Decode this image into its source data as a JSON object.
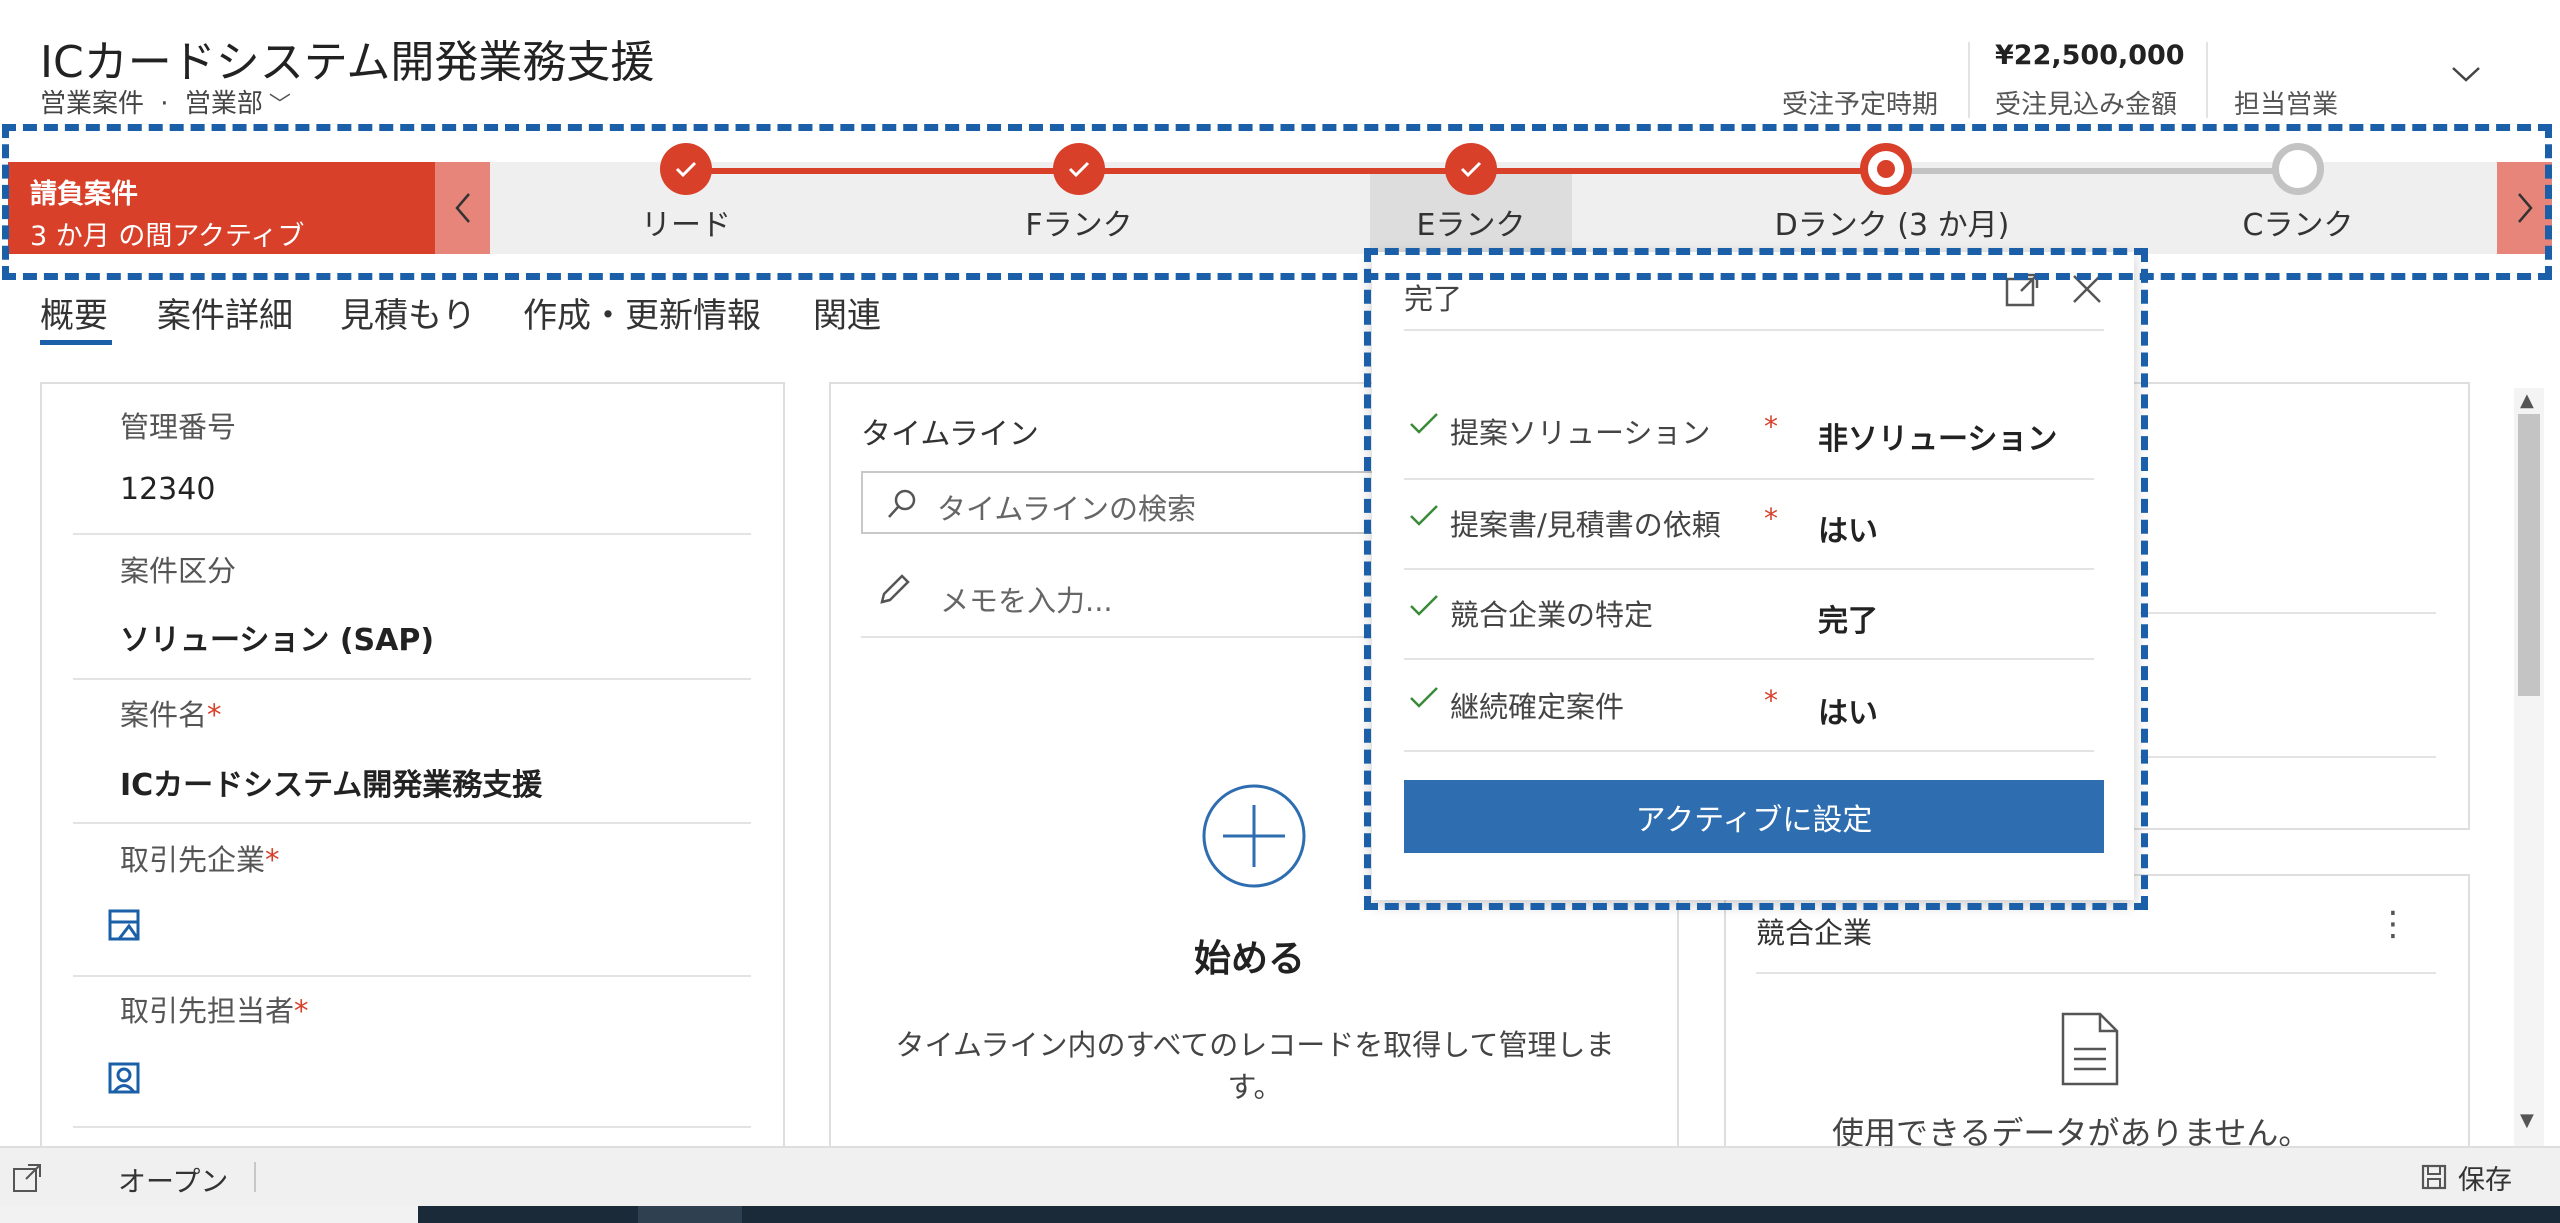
{
  "header": {
    "title": "ICカードシステム開発業務支援",
    "entity_type": "営業案件",
    "separator": "·",
    "form_name": "営業部",
    "fields": [
      {
        "label": "受注予定時期",
        "value": ""
      },
      {
        "label": "受注見込み金額",
        "value": "¥22,500,000"
      },
      {
        "label": "担当営業",
        "value": ""
      }
    ]
  },
  "process": {
    "active_stage_name": "請負案件",
    "active_stage_duration": "3 か月 の間アクティブ",
    "stages": [
      {
        "label": "リード",
        "state": "done"
      },
      {
        "label": "Fランク",
        "state": "done"
      },
      {
        "label": "Eランク",
        "state": "done"
      },
      {
        "label": "Dランク (3 か月)",
        "state": "current"
      },
      {
        "label": "Cランク",
        "state": "future"
      }
    ],
    "accent_color": "#d9402a",
    "highlight_color": "#1a5fa8"
  },
  "tabs": [
    "概要",
    "案件詳細",
    "見積もり",
    "作成・更新情報",
    "関連"
  ],
  "form": {
    "fields": [
      {
        "label": "管理番号",
        "required": false,
        "value": "12340"
      },
      {
        "label": "案件区分",
        "required": false,
        "value": "ソリューション (SAP)"
      },
      {
        "label": "案件名",
        "required": true,
        "value": "ICカードシステム開発業務支援"
      },
      {
        "label": "取引先企業",
        "required": true,
        "value": ""
      },
      {
        "label": "取引先担当者",
        "required": true,
        "value": ""
      }
    ],
    "required_mark": "*"
  },
  "timeline": {
    "title": "タイムライン",
    "search_placeholder": "タイムラインの検索",
    "note_placeholder": "メモを入力...",
    "empty_title": "始める",
    "empty_text_line1": "タイムライン内のすべてのレコードを取得して管理しま",
    "empty_text_line2": "す。"
  },
  "competitors": {
    "title": "競合企業",
    "empty_text": "使用できるデータがありません。"
  },
  "flyout": {
    "title": "完了",
    "rows": [
      {
        "label": "提案ソリューション",
        "required": true,
        "value": "非ソリューション"
      },
      {
        "label": "提案書/見積書の依頼",
        "required": true,
        "value": "はい"
      },
      {
        "label": "競合企業の特定",
        "required": false,
        "value": "完了"
      },
      {
        "label": "継続確定案件",
        "required": true,
        "value": "はい"
      }
    ],
    "button_label": "アクティブに設定"
  },
  "footer": {
    "open_label": "オープン",
    "save_label": "保存"
  }
}
